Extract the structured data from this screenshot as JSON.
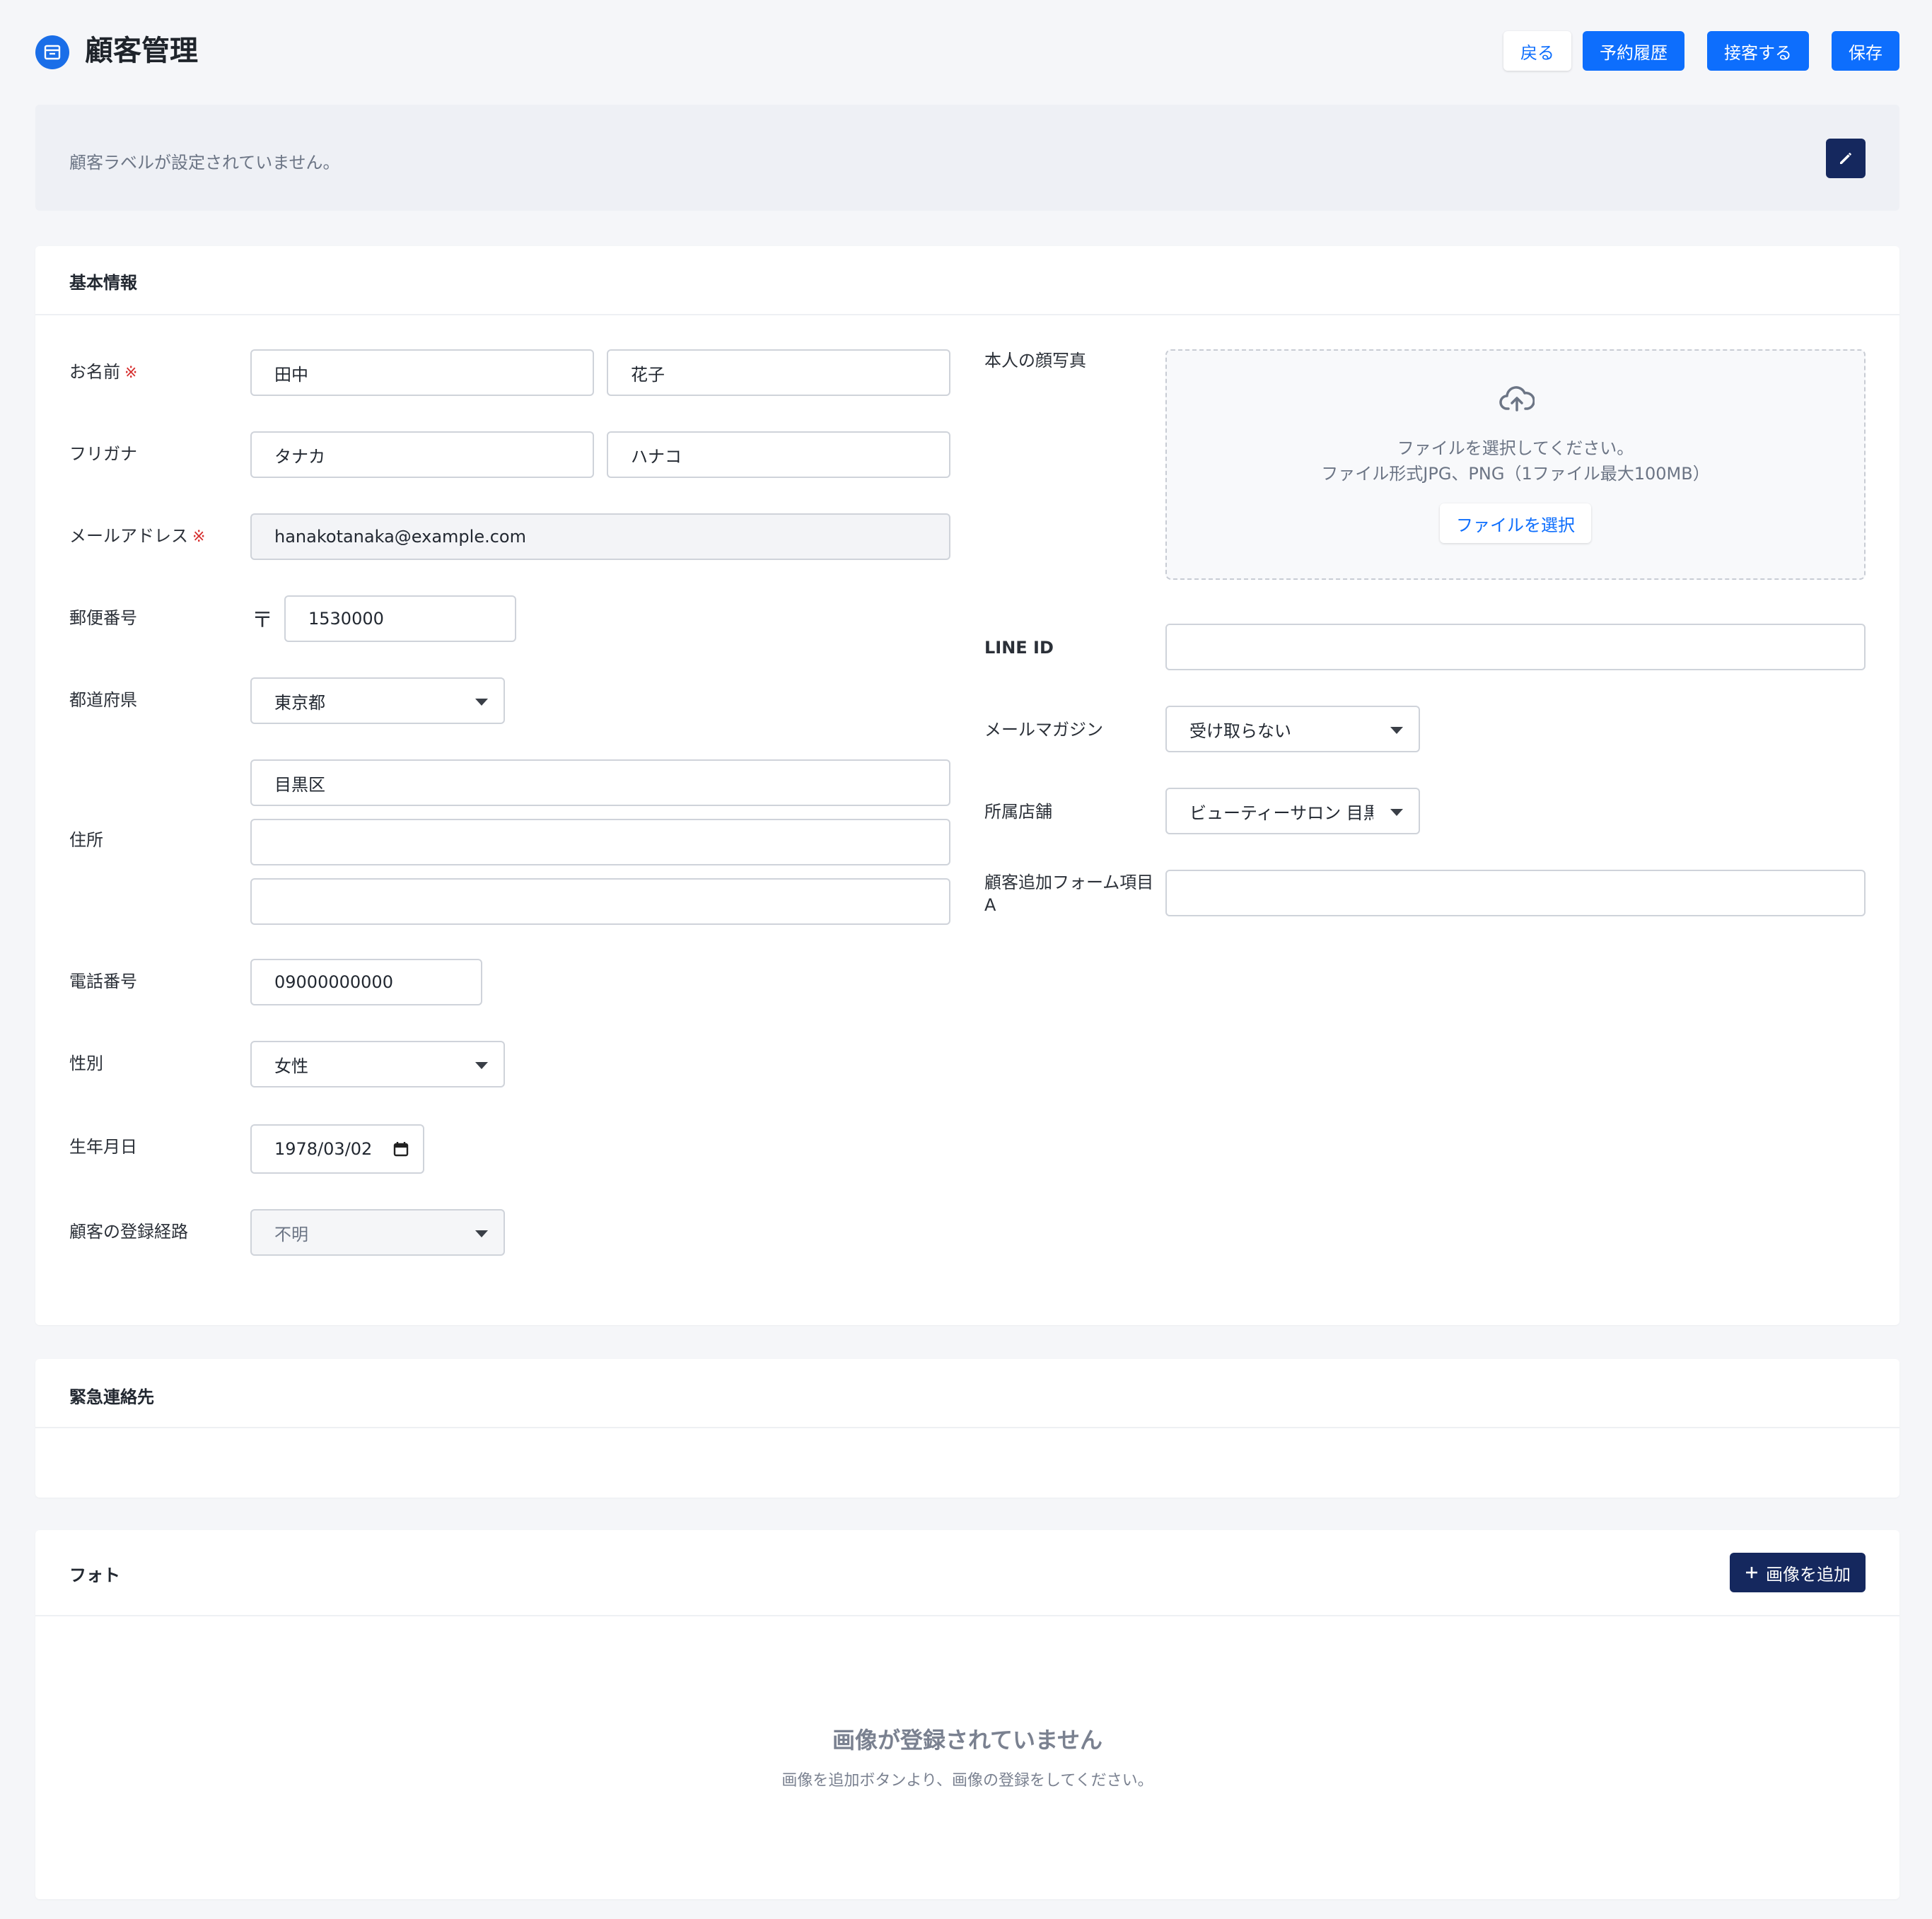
{
  "header": {
    "title": "顧客管理",
    "buttons": {
      "back": "戻る",
      "history": "予約履歴",
      "serve": "接客する",
      "save": "保存"
    }
  },
  "label_banner": {
    "text": "顧客ラベルが設定されていません。"
  },
  "basic_info": {
    "title": "基本情報",
    "name": {
      "label": "お名前",
      "required_mark": "※",
      "last": "田中",
      "first": "花子"
    },
    "furigana": {
      "label": "フリガナ",
      "last": "タナカ",
      "first": "ハナコ"
    },
    "email": {
      "label": "メールアドレス",
      "required_mark": "※",
      "value": "hanakotanaka@example.com"
    },
    "postal": {
      "label": "郵便番号",
      "symbol": "〒",
      "value": "1530000"
    },
    "prefecture": {
      "label": "都道府県",
      "value": "東京都"
    },
    "address": {
      "label": "住所",
      "line1": "目黒区",
      "line2": "",
      "line3": ""
    },
    "phone": {
      "label": "電話番号",
      "value": "09000000000"
    },
    "gender": {
      "label": "性別",
      "value": "女性"
    },
    "birthday": {
      "label": "生年月日",
      "value": "1978/03/02"
    },
    "registration_route": {
      "label": "顧客の登録経路",
      "value": "不明"
    },
    "photo": {
      "label": "本人の顔写真",
      "hint1": "ファイルを選択してください。",
      "hint2": "ファイル形式JPG、PNG（1ファイル最大100MB）",
      "button": "ファイルを選択"
    },
    "line_id": {
      "label": "LINE ID",
      "value": ""
    },
    "newsletter": {
      "label": "メールマガジン",
      "value": "受け取らない"
    },
    "store": {
      "label": "所属店舗",
      "value": "ビューティーサロン 目黒"
    },
    "custom_a": {
      "label": "顧客追加フォーム項目A",
      "value": ""
    }
  },
  "emergency": {
    "title": "緊急連絡先"
  },
  "photos": {
    "title": "フォト",
    "add_button": "画像を追加",
    "empty_title": "画像が登録されていません",
    "empty_sub": "画像を追加ボタンより、画像の登録をしてください。"
  },
  "colors": {
    "primary": "#0d6efd",
    "navy": "#15285e",
    "required": "#d62d2d",
    "background": "#f5f6f9"
  },
  "icons": {
    "app": "customer-card-icon",
    "edit": "pencil-icon",
    "upload": "cloud-upload-icon",
    "calendar": "calendar-icon",
    "add": "plus-icon"
  }
}
